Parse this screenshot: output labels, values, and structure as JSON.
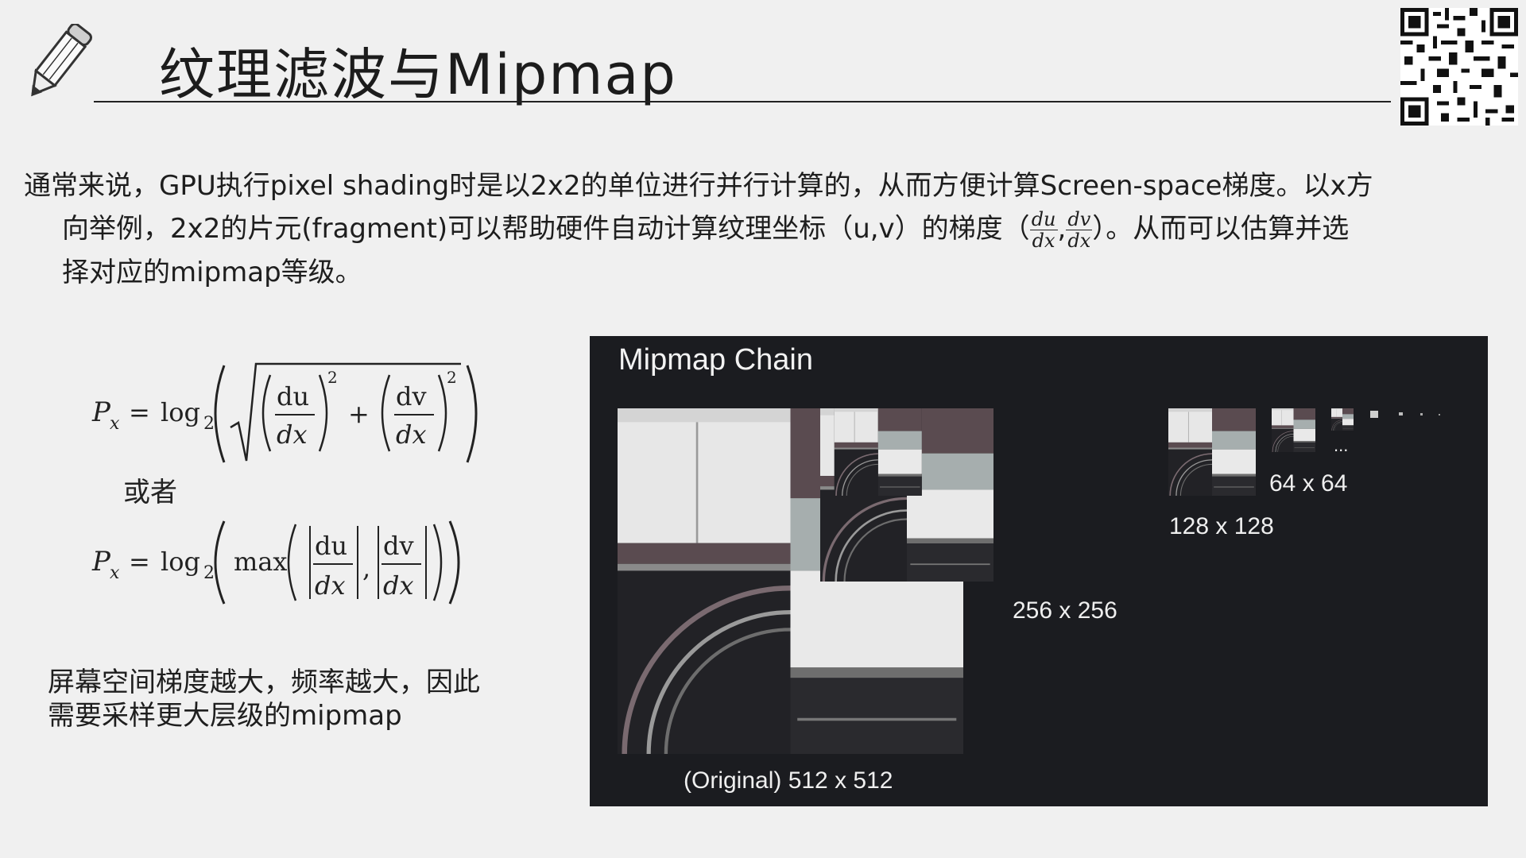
{
  "slide": {
    "title": "纹理滤波与Mipmap",
    "paragraph": {
      "line1": "通常来说，GPU执行pixel shading时是以2x2的单位进行并行计算的，从而方便计算Screen-space梯度。以x方",
      "line2_a": "向举例，2x2的片元(fragment)可以帮助硬件自动计算纹理坐标（u,v）的梯度（",
      "frac1_num": "du",
      "frac1_den": "dx",
      "frac_sep": ",",
      "frac2_num": "dv",
      "frac2_den": "dx",
      "line2_b": "）。从而可以估算并选",
      "line3": "择对应的mipmap等级。"
    },
    "formula1": {
      "lhs": "P",
      "sub": "x",
      "eq": "=",
      "log": "log",
      "log_base": "2",
      "du": "du",
      "dv": "dv",
      "dx": "dx",
      "exp": "2",
      "plus": "+"
    },
    "or_text": "或者",
    "formula2": {
      "lhs": "P",
      "sub": "x",
      "eq": "=",
      "log": "log",
      "log_base": "2",
      "max": "max",
      "du": "du",
      "dv": "dv",
      "dx": "dx",
      "comma": ","
    },
    "note": {
      "line1": "屏幕空间梯度越大，频率越大，因此",
      "line2": "需要采样更大层级的mipmap"
    }
  },
  "mipmap_panel": {
    "title": "Mipmap Chain",
    "captions": {
      "original": "(Original) 512 x 512",
      "level1": "256 x 256",
      "level2": "128 x 128",
      "level3": "64 x 64",
      "ellipsis": "..."
    }
  },
  "colors": {
    "background": "#f0f0f0",
    "panel": "#1b1c20",
    "plum": "#5a4b50",
    "teal_gray": "#a6aeae",
    "tile_light": "#e7e7e7"
  }
}
